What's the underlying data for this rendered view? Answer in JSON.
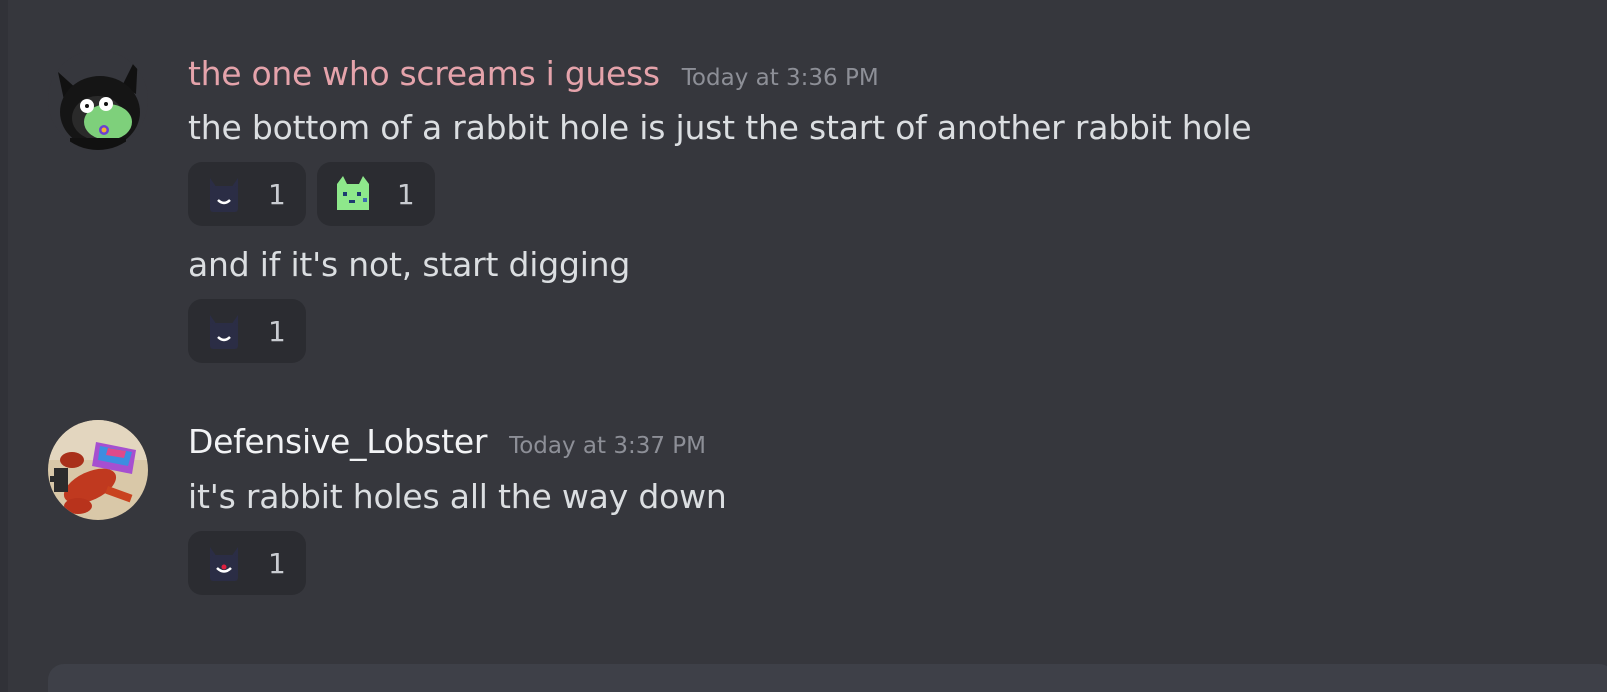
{
  "messages": [
    {
      "author": "the one who screams i guess",
      "author_color": "#e5a3ab",
      "timestamp": "Today at 3:36 PM",
      "avatar_icon": "black-cat-hoodie-avatar",
      "lines": [
        {
          "text": "the bottom of a rabbit hole is just the start of another rabbit hole",
          "reactions": [
            {
              "emoji": "dark-cat-smile-emoji",
              "count": "1"
            },
            {
              "emoji": "green-cat-emoji",
              "count": "1"
            }
          ]
        },
        {
          "text": "and if it's not, start digging",
          "reactions": [
            {
              "emoji": "dark-cat-smile-emoji",
              "count": "1"
            }
          ]
        }
      ]
    },
    {
      "author": "Defensive_Lobster",
      "author_color": "#f2f3f5",
      "timestamp": "Today at 3:37 PM",
      "avatar_icon": "lobster-avatar",
      "lines": [
        {
          "text": "it's rabbit holes all the way down",
          "reactions": [
            {
              "emoji": "dark-cat-red-smile-emoji",
              "count": "1"
            }
          ]
        }
      ]
    }
  ]
}
